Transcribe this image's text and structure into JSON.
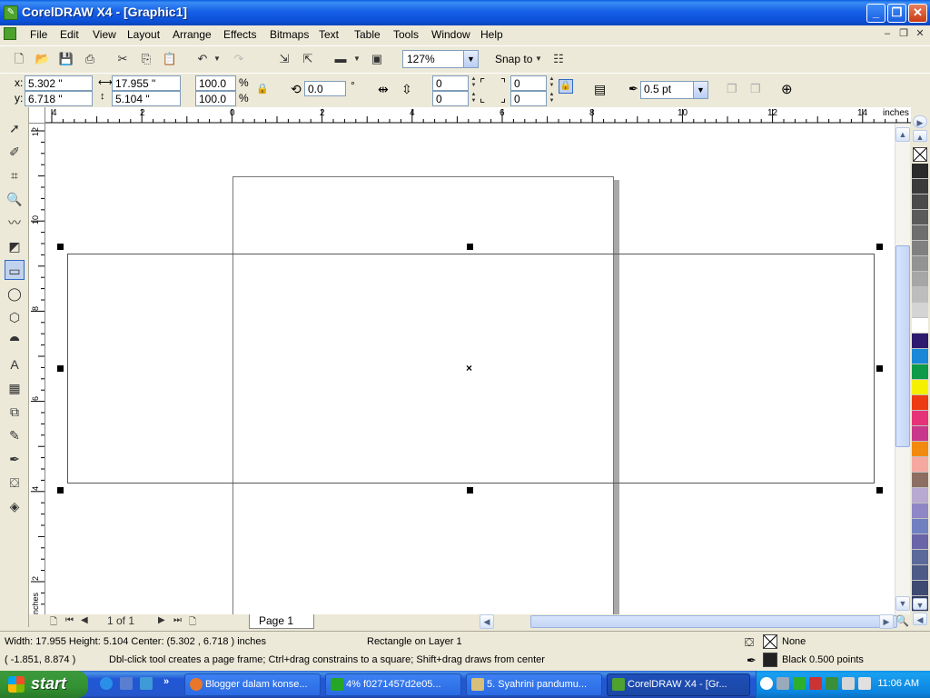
{
  "window": {
    "title": "CorelDRAW X4 - [Graphic1]"
  },
  "menu": [
    "File",
    "Edit",
    "View",
    "Layout",
    "Arrange",
    "Effects",
    "Bitmaps",
    "Text",
    "Table",
    "Tools",
    "Window",
    "Help"
  ],
  "toolbar": {
    "zoom": "127%",
    "snap_to": "Snap to"
  },
  "propertybar": {
    "x": "5.302 \"",
    "y": "6.718 \"",
    "width": "17.955 \"",
    "height": "5.104 \"",
    "scale_x": "100.0",
    "scale_y": "100.0",
    "percent": "%",
    "rotation": "0.0",
    "degree": "°",
    "corner_tl": "0",
    "corner_bl": "0",
    "corner_tr": "0",
    "corner_br": "0",
    "outline_width": "0.5 pt",
    "x_label": "x:",
    "y_label": "y:"
  },
  "ruler": {
    "units": "inches",
    "h_ticks": [
      "4",
      "2",
      "0",
      "2",
      "4",
      "6",
      "8",
      "10",
      "12",
      "14"
    ],
    "v_ticks": [
      "12",
      "10",
      "8",
      "6",
      "4",
      "2"
    ],
    "v_units": "inches"
  },
  "page_nav": {
    "page_count": "1 of 1",
    "tab": "Page 1"
  },
  "status": {
    "dimensions": "Width: 17.955  Height: 5.104   Center: (5.302 , 6.718 )  inches",
    "layer": "Rectangle on Layer 1",
    "cursor": "( -1.851, 8.874  )",
    "hint": "Dbl-click tool creates a page frame; Ctrl+drag constrains to a square; Shift+drag draws from center",
    "fill": "None",
    "outline": "Black  0.500 points"
  },
  "palette": [
    "#2b2b2b",
    "#3a3a3a",
    "#4a4a4a",
    "#5b5b5b",
    "#6e6e6e",
    "#808080",
    "#939393",
    "#a6a6a6",
    "#bdbdbd",
    "#d4d4d4",
    "#ffffff",
    "#2e1a6e",
    "#1a88d8",
    "#0e9a48",
    "#f5f000",
    "#ee3a12",
    "#e63279",
    "#c9378a",
    "#f28a10",
    "#f5a8a0",
    "#8d6e63",
    "#b7a9cf",
    "#8f86c6",
    "#6f7fc0",
    "#6a64a8",
    "#5b6a9a",
    "#4d5a86",
    "#3f4a72",
    "#30395e"
  ],
  "taskbar": {
    "start": "start",
    "tasks": [
      "Blogger dalam konse...",
      "4% f0271457d2e05...",
      "5. Syahrini pandumu...",
      "CorelDRAW X4 - [Gr..."
    ],
    "clock": "11:06 AM"
  }
}
